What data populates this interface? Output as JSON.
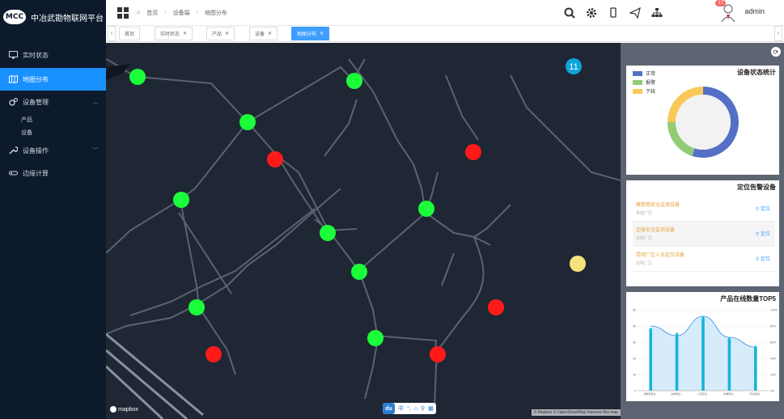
{
  "app": {
    "logo_text": "MCC",
    "title": "中冶武勘物联网平台"
  },
  "sidebar": {
    "items": [
      {
        "label": "实时状态",
        "icon": "monitor-icon"
      },
      {
        "label": "地图分布",
        "icon": "map-icon",
        "active": true
      },
      {
        "label": "设备管理",
        "icon": "gears-icon"
      },
      {
        "label": "设备操作",
        "icon": "wrench-icon"
      },
      {
        "label": "边缘计算",
        "icon": "edge-icon"
      }
    ],
    "sub_items": [
      "产品",
      "设备"
    ]
  },
  "header": {
    "breadcrumb": [
      "首页",
      "设备端",
      "地图分布"
    ],
    "user": {
      "name": "admin",
      "badge": "17"
    }
  },
  "tabs": [
    {
      "label": "首页",
      "closable": false
    },
    {
      "label": "实时状态",
      "closable": true
    },
    {
      "label": "产品",
      "closable": true
    },
    {
      "label": "设备",
      "closable": true
    },
    {
      "label": "地图分布",
      "closable": true,
      "active": true
    }
  ],
  "map": {
    "cluster_count": "11",
    "logo": "mapbox",
    "attribution": "© Mapbox © OpenStreetMap  Improve this map",
    "toolbar": [
      "中",
      "°,",
      "⌂",
      "⚲",
      "▦"
    ],
    "toolbar_brand": "du",
    "marker_colors": {
      "online": "#1aff3a",
      "alarm": "#ff1a1a",
      "offline": "#f5e27a"
    }
  },
  "status_chart": {
    "title": "设备状态统计",
    "legend": [
      {
        "name": "正常",
        "color": "#5470c6",
        "value": 55
      },
      {
        "name": "报警",
        "color": "#91cc75",
        "value": 20
      },
      {
        "name": "下线",
        "color": "#fac858",
        "value": 25
      }
    ]
  },
  "alarms": {
    "title": "定位告警设备",
    "items": [
      {
        "name": "建筑物安全监测设备",
        "location": "某施厂区",
        "action": "定位"
      },
      {
        "name": "边坡安全监测设备",
        "location": "昆明厂区",
        "action": "定位"
      },
      {
        "name": "昆明厂区人员定位设备",
        "location": "昆明厂区",
        "action": "定位"
      }
    ]
  },
  "chart_data": {
    "type": "bar",
    "title": "产品在线数量TOP5",
    "categories": [
      "建筑物安全...",
      "边坡安全...",
      "人员定位...",
      "车辆定位...",
      "环境监测..."
    ],
    "values": [
      38,
      35,
      45,
      32,
      27
    ],
    "line": [
      40,
      34,
      46,
      33,
      27
    ],
    "y_left": {
      "ticks": [
        0,
        10,
        20,
        30,
        40,
        50
      ]
    },
    "y_right": {
      "ticks": [
        "0%",
        "20%",
        "40%",
        "60%",
        "80%",
        "100%"
      ]
    }
  }
}
